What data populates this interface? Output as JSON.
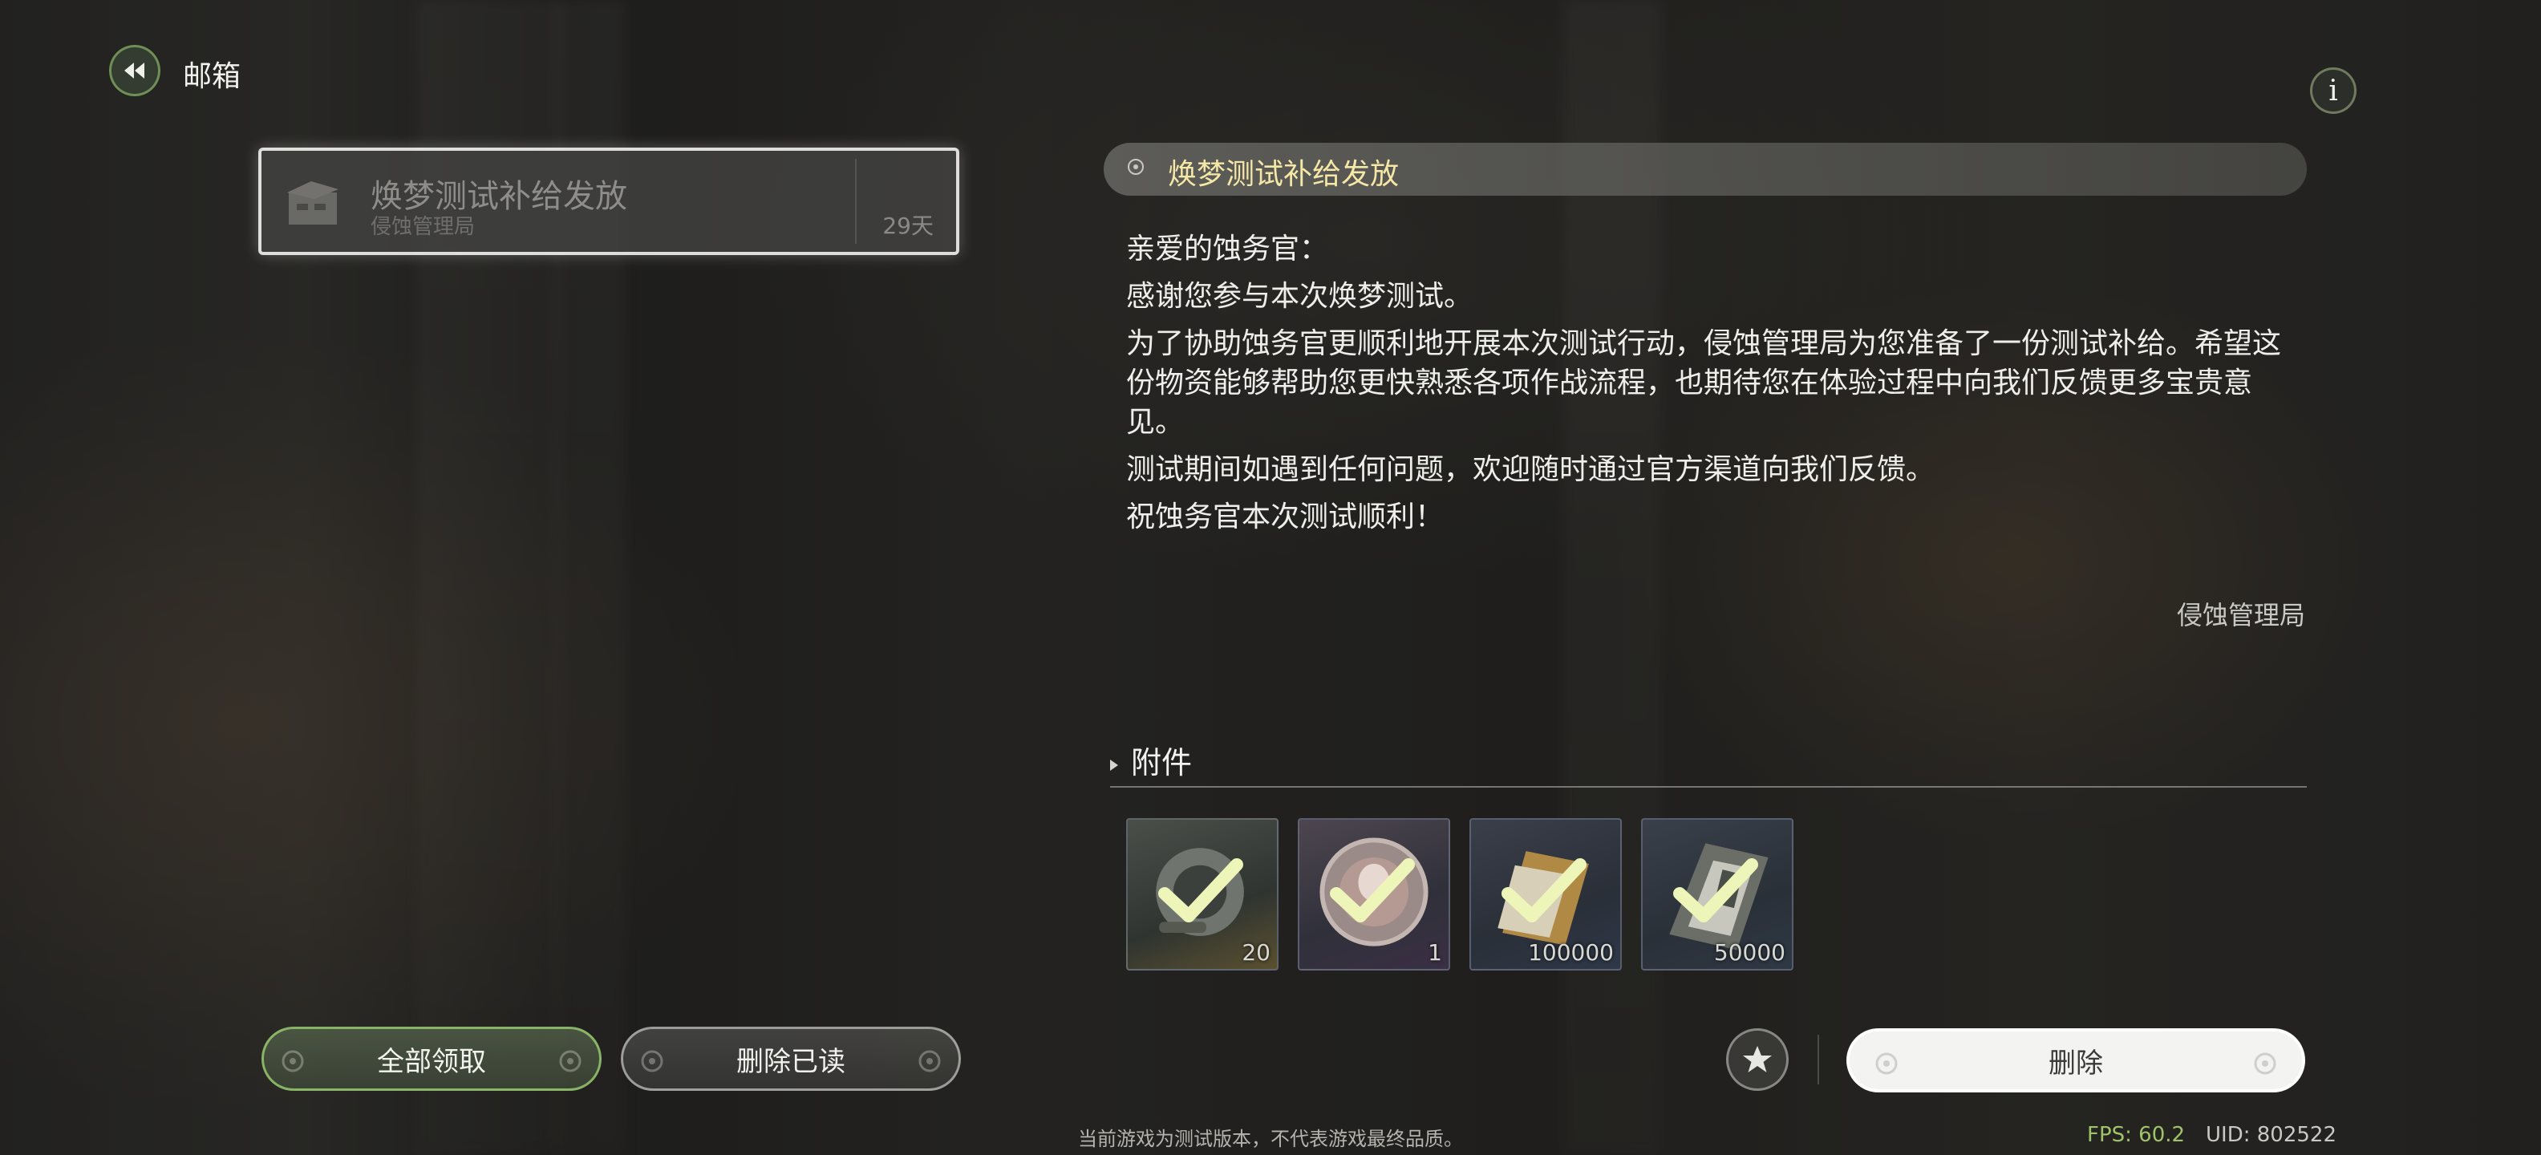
{
  "header": {
    "title": "邮箱",
    "back_icon": "rewind-icon",
    "info_label": "i"
  },
  "mail_list": [
    {
      "title": "焕梦测试补给发放",
      "sender": "侵蚀管理局",
      "days": "29天",
      "icon": "box-icon",
      "selected": true
    }
  ],
  "detail": {
    "title": "焕梦测试补给发放",
    "paragraphs": [
      "亲爱的蚀务官：",
      "感谢您参与本次焕梦测试。",
      "为了协助蚀务官更顺利地开展本次测试行动，侵蚀管理局为您准备了一份测试补给。希望这份物资能够帮助您更快熟悉各项作战流程，也期待您在体验过程中向我们反馈更多宝贵意见。",
      "测试期间如遇到任何问题，欢迎随时通过官方渠道向我们反馈。",
      "祝蚀务官本次测试顺利！"
    ],
    "signature": "侵蚀管理局"
  },
  "attachments": {
    "heading": "附件",
    "items": [
      {
        "count": "20",
        "icon": "gear-item-icon",
        "claimed": true
      },
      {
        "count": "1",
        "icon": "character-token-icon",
        "claimed": true
      },
      {
        "count": "100000",
        "icon": "gold-card-icon",
        "claimed": true
      },
      {
        "count": "50000",
        "icon": "chip-card-icon",
        "claimed": true
      }
    ]
  },
  "buttons": {
    "collect_all": "全部领取",
    "delete_read": "删除已读",
    "favorite_icon": "star-icon",
    "delete": "删除"
  },
  "footer": {
    "disclaimer": "当前游戏为测试版本，不代表游戏最终品质。",
    "fps": "FPS: 60.2",
    "uid": "UID: 802522"
  },
  "colors": {
    "accent_green": "#9fc36a",
    "title_yellow": "#f5e7a6",
    "check_glow": "#eef5b8"
  }
}
